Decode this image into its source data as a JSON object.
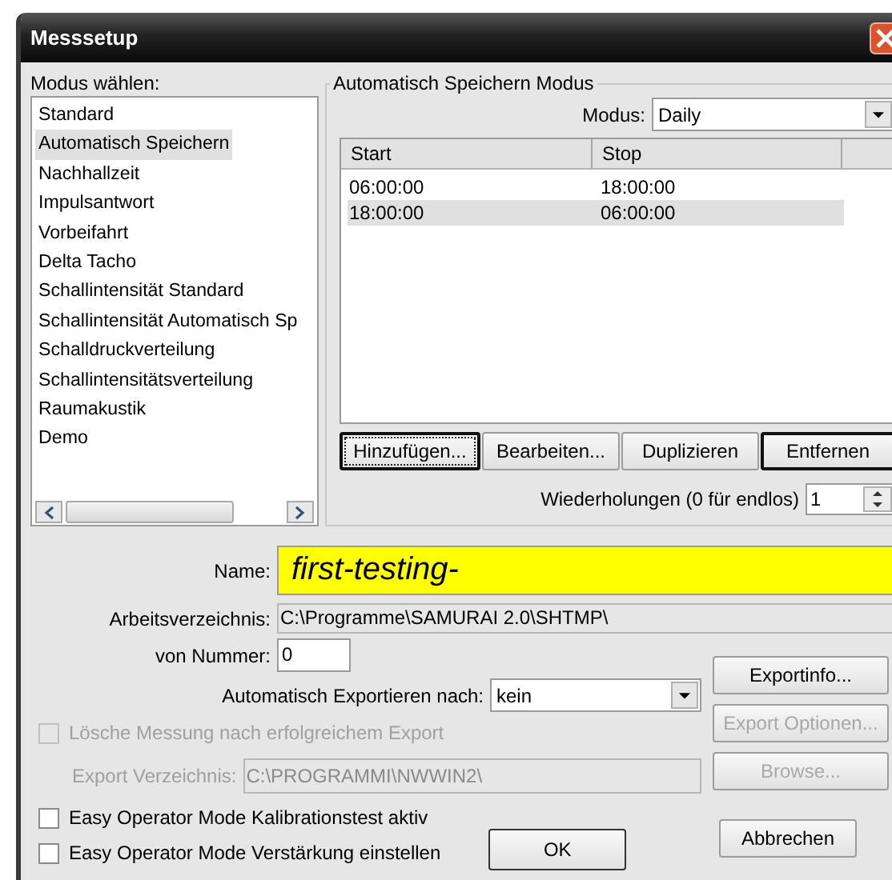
{
  "window": {
    "title": "Messsetup"
  },
  "mode_list": {
    "label": "Modus wählen:",
    "items": [
      {
        "label": "Standard",
        "selected": false
      },
      {
        "label": "Automatisch Speichern",
        "selected": true
      },
      {
        "label": "Nachhallzeit",
        "selected": false
      },
      {
        "label": "Impulsantwort",
        "selected": false
      },
      {
        "label": "Vorbeifahrt",
        "selected": false
      },
      {
        "label": "Delta Tacho",
        "selected": false
      },
      {
        "label": "Schallintensität Standard",
        "selected": false
      },
      {
        "label": "Schallintensität Automatisch Sp",
        "selected": false
      },
      {
        "label": "Schalldruckverteilung",
        "selected": false
      },
      {
        "label": "Schallintensitätsverteilung",
        "selected": false
      },
      {
        "label": "Raumakustik",
        "selected": false
      },
      {
        "label": "Demo",
        "selected": false
      }
    ]
  },
  "group": {
    "title": "Automatisch Speichern Modus",
    "mode_label": "Modus:",
    "mode_value": "Daily",
    "columns": [
      "Start",
      "Stop"
    ],
    "rows": [
      {
        "start": "06:00:00",
        "stop": "18:00:00",
        "selected": false
      },
      {
        "start": "18:00:00",
        "stop": "06:00:00",
        "selected": true
      }
    ],
    "buttons": [
      {
        "label": "Hinzufügen...",
        "kind": "focused"
      },
      {
        "label": "Bearbeiten...",
        "kind": "normal"
      },
      {
        "label": "Duplizieren",
        "kind": "normal"
      },
      {
        "label": "Entfernen",
        "kind": "default"
      }
    ],
    "repeat": {
      "label": "Wiederholungen (0 für endlos)",
      "value": "1"
    }
  },
  "name": {
    "label": "Name:",
    "value": "first-testing-"
  },
  "work_dir": {
    "label": "Arbeitsverzeichnis:",
    "value": "C:\\Programme\\SAMURAI 2.0\\SHTMP\\"
  },
  "from_number": {
    "label": "von Nummer:",
    "value": "0"
  },
  "auto_export": {
    "label": "Automatisch Exportieren nach:",
    "value": "kein"
  },
  "delete_after": {
    "label": "Lösche Messung nach erfolgreichem Export",
    "checked": false,
    "disabled": true
  },
  "export_dir": {
    "label": "Export Verzeichnis:",
    "value": "C:\\PROGRAMMI\\NWWIN2\\",
    "disabled": true
  },
  "side_buttons": [
    {
      "label": "Exportinfo...",
      "disabled": false
    },
    {
      "label": "Export Optionen...",
      "disabled": true
    },
    {
      "label": "Browse...",
      "disabled": true
    }
  ],
  "options": [
    {
      "label": "Easy Operator Mode Kalibrationstest aktiv",
      "checked": false
    },
    {
      "label": "Easy Operator Mode Verstärkung einstellen",
      "checked": false
    }
  ],
  "ok": {
    "label": "OK"
  },
  "cancel": {
    "label": "Abbrechen"
  }
}
